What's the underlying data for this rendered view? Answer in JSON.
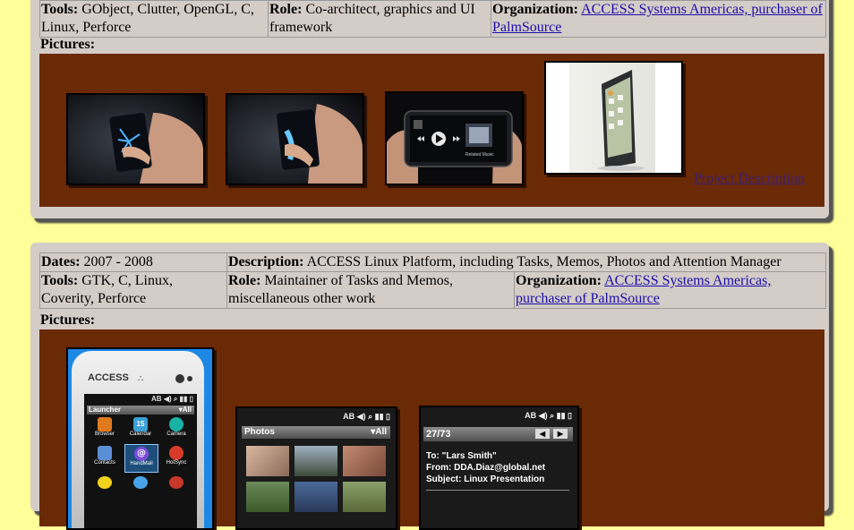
{
  "project1": {
    "tools_label": "Tools:",
    "tools": "GObject, Clutter, OpenGL, C, Linux, Perforce",
    "role_label": "Role:",
    "role": "Co-architect, graphics and UI framework",
    "org_label": "Organization:",
    "org_link": "ACCESS Systems Americas, purchaser of PalmSource",
    "pictures_label": "Pictures:",
    "project_link": "Project Description"
  },
  "project2": {
    "dates_label": "Dates:",
    "dates": "2007 - 2008",
    "desc_label": "Description:",
    "desc": "ACCESS Linux Platform, including Tasks, Memos, Photos and Attention Manager",
    "tools_label": "Tools:",
    "tools": "GTK, C, Linux, Coverity, Perforce",
    "role_label": "Role:",
    "role": "Maintainer of Tasks and Memos, miscellaneous other work",
    "org_label": "Organization:",
    "org_link": "ACCESS Systems Americas, purchaser of PalmSource",
    "pictures_label": "Pictures:"
  },
  "screens": {
    "launcher": {
      "brand": "ACCESS",
      "status": "AB",
      "title": "Launcher",
      "filter": "All",
      "apps": [
        "Browser",
        "Calendar",
        "Camera",
        "Contacts",
        "HandMail",
        "HotSync"
      ]
    },
    "photos": {
      "status": "AB",
      "title": "Photos",
      "filter": "All"
    },
    "mail": {
      "status": "AB",
      "counter": "27/73",
      "to": "To: \"Lars Smith\"",
      "from": "From: DDA.Diaz@global.net",
      "subject": "Subject: Linux Presentation"
    },
    "music": {
      "caption": "Related Music"
    }
  },
  "colors": {
    "page_bg": "#ffff99",
    "panel_bg": "#d4ccc7",
    "gallery_bg": "#6b2a06",
    "link": "#1a0dab"
  }
}
